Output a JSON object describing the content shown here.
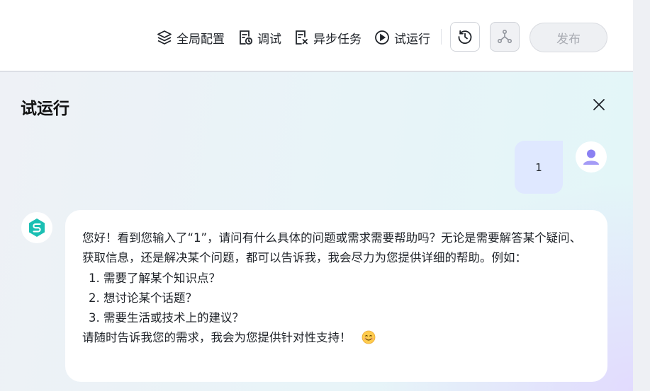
{
  "toolbar": {
    "global_config": "全局配置",
    "debug": "调试",
    "async_task": "异步任务",
    "trial_run": "试运行",
    "publish": "发布"
  },
  "panel": {
    "title": "试运行"
  },
  "messages": {
    "user_text": "1",
    "bot_intro": "您好！看到您输入了“1”，请问有什么具体的问题或需求需要帮助吗？无论是需要解答某个疑问、获取信息，还是解决某个问题，都可以告诉我，我会尽力为您提供详细的帮助。例如：",
    "bot_list": [
      "需要了解某个知识点？",
      "想讨论某个话题？",
      "需要生活或技术上的建议？"
    ],
    "bot_outro": "请随时告诉我您的需求，我会为您提供针对性支持！"
  },
  "icons": {
    "global_config": "layers-icon",
    "debug": "document-clock-icon",
    "async_task": "document-close-icon",
    "trial_run": "play-circle-icon",
    "history": "history-icon",
    "share": "share-nodes-icon",
    "close": "close-icon",
    "user_avatar": "user-avatar-icon",
    "bot_avatar": "bot-logo-icon",
    "emoji": "smiling-face-emoji"
  },
  "colors": {
    "user_bubble": "#dfe8ff",
    "bot_logo": "#1bbfb3",
    "user_avatar": "#8a80f2",
    "publish_disabled_text": "#a9acb3"
  }
}
